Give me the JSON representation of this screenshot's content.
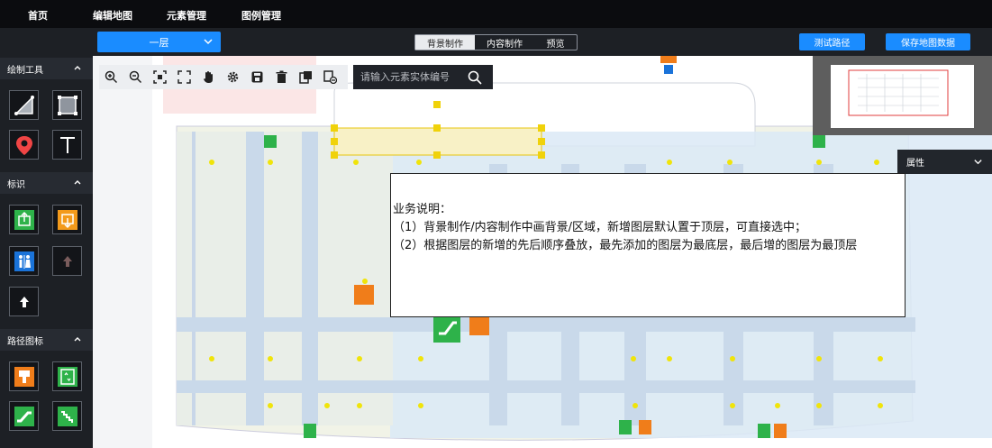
{
  "nav": [
    "首页",
    "编辑地图",
    "元素管理",
    "图例管理"
  ],
  "floor": {
    "selected": "一层"
  },
  "modes": [
    "背景制作",
    "内容制作",
    "预览"
  ],
  "actions": {
    "test_route": "测试路径",
    "save_map": "保存地图数据"
  },
  "sidebar": {
    "draw_tools": "绘制工具",
    "markers": "标识",
    "route_icons": "路径图标"
  },
  "search": {
    "placeholder": "请输入元素实体编号"
  },
  "panel": {
    "properties": "属性"
  },
  "note": {
    "title": "业务说明：",
    "line1": "（1）背景制作/内容制作中画背景/区域，新增图层默认置于顶层，可直接选中；",
    "line2": "（2）根据图层的新增的先后顺序叠放，最先添加的图层为最底层，最后增的图层为最顶层"
  },
  "colors": {
    "accent": "#1a8cff",
    "node": "#f0e40a",
    "exit_green": "#2eb24a",
    "sign_orange": "#f07d1a"
  }
}
